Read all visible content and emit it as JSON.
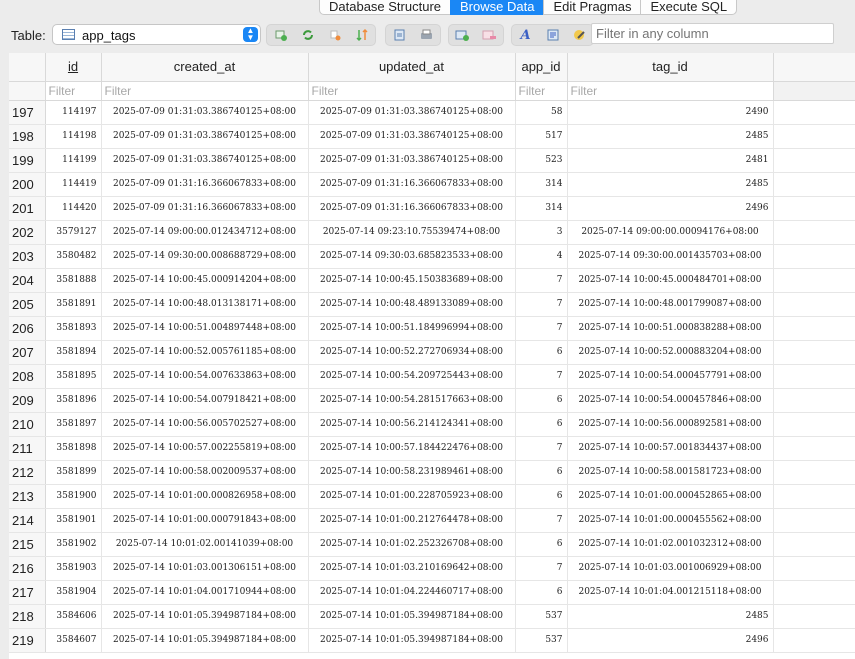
{
  "tabs": [
    {
      "label": "Database Structure",
      "active": false
    },
    {
      "label": "Browse Data",
      "active": true
    },
    {
      "label": "Edit Pragmas",
      "active": false
    },
    {
      "label": "Execute SQL",
      "active": false
    }
  ],
  "toolbar": {
    "table_label": "Table:",
    "table_name": "app_tags",
    "filter_all_placeholder": "Filter in any column"
  },
  "grid": {
    "columns": [
      "id",
      "created_at",
      "updated_at",
      "app_id",
      "tag_id"
    ],
    "filter_placeholder": "Filter",
    "rows": [
      {
        "n": "197",
        "id": "114197",
        "created_at": "2025-07-09 01:31:03.386740125+08:00",
        "updated_at": "2025-07-09 01:31:03.386740125+08:00",
        "app_id": "58",
        "tag_id": "2490"
      },
      {
        "n": "198",
        "id": "114198",
        "created_at": "2025-07-09 01:31:03.386740125+08:00",
        "updated_at": "2025-07-09 01:31:03.386740125+08:00",
        "app_id": "517",
        "tag_id": "2485"
      },
      {
        "n": "199",
        "id": "114199",
        "created_at": "2025-07-09 01:31:03.386740125+08:00",
        "updated_at": "2025-07-09 01:31:03.386740125+08:00",
        "app_id": "523",
        "tag_id": "2481"
      },
      {
        "n": "200",
        "id": "114419",
        "created_at": "2025-07-09 01:31:16.366067833+08:00",
        "updated_at": "2025-07-09 01:31:16.366067833+08:00",
        "app_id": "314",
        "tag_id": "2485"
      },
      {
        "n": "201",
        "id": "114420",
        "created_at": "2025-07-09 01:31:16.366067833+08:00",
        "updated_at": "2025-07-09 01:31:16.366067833+08:00",
        "app_id": "314",
        "tag_id": "2496"
      },
      {
        "n": "202",
        "id": "3579127",
        "created_at": "2025-07-14 09:00:00.012434712+08:00",
        "updated_at": "2025-07-14 09:23:10.75539474+08:00",
        "app_id": "3",
        "tag_id": "2025-07-14 09:00:00.00094176+08:00"
      },
      {
        "n": "203",
        "id": "3580482",
        "created_at": "2025-07-14 09:30:00.008688729+08:00",
        "updated_at": "2025-07-14 09:30:03.685823533+08:00",
        "app_id": "4",
        "tag_id": "2025-07-14 09:30:00.001435703+08:00"
      },
      {
        "n": "204",
        "id": "3581888",
        "created_at": "2025-07-14 10:00:45.000914204+08:00",
        "updated_at": "2025-07-14 10:00:45.150383689+08:00",
        "app_id": "7",
        "tag_id": "2025-07-14 10:00:45.000484701+08:00"
      },
      {
        "n": "205",
        "id": "3581891",
        "created_at": "2025-07-14 10:00:48.013138171+08:00",
        "updated_at": "2025-07-14 10:00:48.489133089+08:00",
        "app_id": "7",
        "tag_id": "2025-07-14 10:00:48.001799087+08:00"
      },
      {
        "n": "206",
        "id": "3581893",
        "created_at": "2025-07-14 10:00:51.004897448+08:00",
        "updated_at": "2025-07-14 10:00:51.184996994+08:00",
        "app_id": "7",
        "tag_id": "2025-07-14 10:00:51.000838288+08:00"
      },
      {
        "n": "207",
        "id": "3581894",
        "created_at": "2025-07-14 10:00:52.005761185+08:00",
        "updated_at": "2025-07-14 10:00:52.272706934+08:00",
        "app_id": "6",
        "tag_id": "2025-07-14 10:00:52.000883204+08:00"
      },
      {
        "n": "208",
        "id": "3581895",
        "created_at": "2025-07-14 10:00:54.007633863+08:00",
        "updated_at": "2025-07-14 10:00:54.209725443+08:00",
        "app_id": "7",
        "tag_id": "2025-07-14 10:00:54.000457791+08:00"
      },
      {
        "n": "209",
        "id": "3581896",
        "created_at": "2025-07-14 10:00:54.007918421+08:00",
        "updated_at": "2025-07-14 10:00:54.281517663+08:00",
        "app_id": "6",
        "tag_id": "2025-07-14 10:00:54.000457846+08:00"
      },
      {
        "n": "210",
        "id": "3581897",
        "created_at": "2025-07-14 10:00:56.005702527+08:00",
        "updated_at": "2025-07-14 10:00:56.214124341+08:00",
        "app_id": "6",
        "tag_id": "2025-07-14 10:00:56.000892581+08:00"
      },
      {
        "n": "211",
        "id": "3581898",
        "created_at": "2025-07-14 10:00:57.002255819+08:00",
        "updated_at": "2025-07-14 10:00:57.184422476+08:00",
        "app_id": "7",
        "tag_id": "2025-07-14 10:00:57.001834437+08:00"
      },
      {
        "n": "212",
        "id": "3581899",
        "created_at": "2025-07-14 10:00:58.002009537+08:00",
        "updated_at": "2025-07-14 10:00:58.231989461+08:00",
        "app_id": "6",
        "tag_id": "2025-07-14 10:00:58.001581723+08:00"
      },
      {
        "n": "213",
        "id": "3581900",
        "created_at": "2025-07-14 10:01:00.000826958+08:00",
        "updated_at": "2025-07-14 10:01:00.228705923+08:00",
        "app_id": "6",
        "tag_id": "2025-07-14 10:01:00.000452865+08:00"
      },
      {
        "n": "214",
        "id": "3581901",
        "created_at": "2025-07-14 10:01:00.000791843+08:00",
        "updated_at": "2025-07-14 10:01:00.212764478+08:00",
        "app_id": "7",
        "tag_id": "2025-07-14 10:01:00.000455562+08:00"
      },
      {
        "n": "215",
        "id": "3581902",
        "created_at": "2025-07-14 10:01:02.00141039+08:00",
        "updated_at": "2025-07-14 10:01:02.252326708+08:00",
        "app_id": "6",
        "tag_id": "2025-07-14 10:01:02.001032312+08:00"
      },
      {
        "n": "216",
        "id": "3581903",
        "created_at": "2025-07-14 10:01:03.001306151+08:00",
        "updated_at": "2025-07-14 10:01:03.210169642+08:00",
        "app_id": "7",
        "tag_id": "2025-07-14 10:01:03.001006929+08:00"
      },
      {
        "n": "217",
        "id": "3581904",
        "created_at": "2025-07-14 10:01:04.001710944+08:00",
        "updated_at": "2025-07-14 10:01:04.224460717+08:00",
        "app_id": "6",
        "tag_id": "2025-07-14 10:01:04.001215118+08:00"
      },
      {
        "n": "218",
        "id": "3584606",
        "created_at": "2025-07-14 10:01:05.394987184+08:00",
        "updated_at": "2025-07-14 10:01:05.394987184+08:00",
        "app_id": "537",
        "tag_id": "2485"
      },
      {
        "n": "219",
        "id": "3584607",
        "created_at": "2025-07-14 10:01:05.394987184+08:00",
        "updated_at": "2025-07-14 10:01:05.394987184+08:00",
        "app_id": "537",
        "tag_id": "2496"
      }
    ]
  }
}
